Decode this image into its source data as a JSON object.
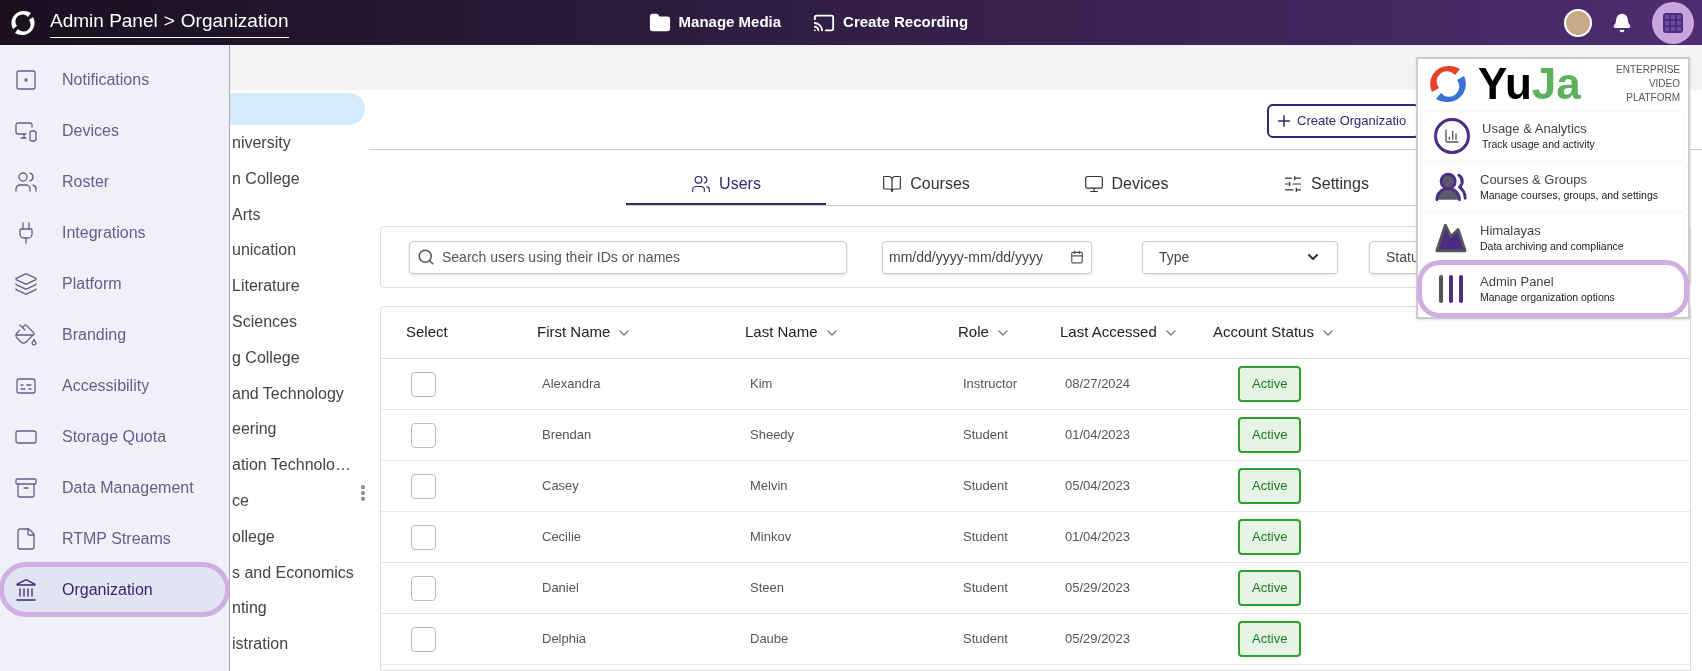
{
  "top_bar": {
    "breadcrumb": [
      {
        "label": "Admin Panel"
      },
      {
        "label": ">"
      },
      {
        "label": "Organization"
      }
    ],
    "actions": [
      {
        "kind": "media",
        "label": "Manage Media"
      },
      {
        "kind": "recording",
        "label": "Create Recording"
      }
    ],
    "apps_button": {
      "active": true
    }
  },
  "sidebar": {
    "items": [
      {
        "kind": "notifications",
        "label": "Notifications",
        "selected": false
      },
      {
        "kind": "devices",
        "label": "Devices",
        "selected": false
      },
      {
        "kind": "roster",
        "label": "Roster",
        "selected": false
      },
      {
        "kind": "integrations",
        "label": "Integrations",
        "selected": false
      },
      {
        "kind": "platform",
        "label": "Platform",
        "selected": false
      },
      {
        "kind": "branding",
        "label": "Branding",
        "selected": false
      },
      {
        "kind": "accessibility",
        "label": "Accessibility",
        "selected": false
      },
      {
        "kind": "storage",
        "label": "Storage Quota",
        "selected": false
      },
      {
        "kind": "data",
        "label": "Data Management",
        "selected": false
      },
      {
        "kind": "rtmp",
        "label": "RTMP Streams",
        "selected": false
      },
      {
        "kind": "organization",
        "label": "Organization",
        "selected": true
      }
    ]
  },
  "org_tree": {
    "items": [
      {
        "label": "niversity"
      },
      {
        "label": "n College"
      },
      {
        "label": "Arts"
      },
      {
        "label": "unication"
      },
      {
        "label": "Literature"
      },
      {
        "label": "Sciences"
      },
      {
        "label": "g College"
      },
      {
        "label": "and Technology"
      },
      {
        "label": "eering"
      },
      {
        "label": "ation Technolo…"
      },
      {
        "label": "ce"
      },
      {
        "label": "ollege"
      },
      {
        "label": "s and Economics"
      },
      {
        "label": "nting"
      },
      {
        "label": "istration"
      }
    ]
  },
  "create_button": "Create Organizatio",
  "tabs": [
    {
      "kind": "users",
      "label": "Users",
      "selected": true
    },
    {
      "kind": "courses",
      "label": "Courses",
      "selected": false
    },
    {
      "kind": "devices",
      "label": "Devices",
      "selected": false
    },
    {
      "kind": "settings",
      "label": "Settings",
      "selected": false
    }
  ],
  "filters": {
    "search": {
      "placeholder": "Search users using their IDs or names"
    },
    "date": {
      "placeholder": "mm/dd/yyyy-mm/dd/yyyy"
    },
    "type": {
      "value": "Type"
    },
    "status": {
      "value": "Statu"
    }
  },
  "table": {
    "columns": [
      "Select",
      "First Name",
      "Last Name",
      "Role",
      "Last Accessed",
      "Account Status"
    ],
    "rows": [
      {
        "checked": false,
        "first_name": "Alexandra",
        "last_name": "Kim",
        "role": "Instructor",
        "last_accessed": "08/27/2024",
        "status": "Active"
      },
      {
        "checked": false,
        "first_name": "Brendan",
        "last_name": "Sheedy",
        "role": "Student",
        "last_accessed": "01/04/2023",
        "status": "Active"
      },
      {
        "checked": false,
        "first_name": "Casey",
        "last_name": "Melvin",
        "role": "Student",
        "last_accessed": "05/04/2023",
        "status": "Active"
      },
      {
        "checked": false,
        "first_name": "Cecilie",
        "last_name": "Minkov",
        "role": "Student",
        "last_accessed": "01/04/2023",
        "status": "Active"
      },
      {
        "checked": false,
        "first_name": "Daniel",
        "last_name": "Steen",
        "role": "Student",
        "last_accessed": "05/29/2023",
        "status": "Active"
      },
      {
        "checked": false,
        "first_name": "Delphia",
        "last_name": "Daube",
        "role": "Student",
        "last_accessed": "05/29/2023",
        "status": "Active"
      }
    ]
  },
  "apps_menu": {
    "logo": {
      "dark": "Yu",
      "green": "Ja"
    },
    "tagline": [
      "ENTERPRISE",
      "VIDEO",
      "PLATFORM"
    ],
    "items": [
      {
        "kind": "analytics",
        "title": "Usage & Analytics",
        "subtitle": "Track usage and activity",
        "highlighted": false
      },
      {
        "kind": "courses",
        "title": "Courses & Groups",
        "subtitle": "Manage courses, groups, and settings",
        "highlighted": false
      },
      {
        "kind": "archive",
        "title": "Himalayas",
        "subtitle": "Data archiving and compliance",
        "highlighted": false
      },
      {
        "kind": "admin",
        "title": "Admin Panel",
        "subtitle": "Manage organization options",
        "highlighted": true
      }
    ]
  }
}
